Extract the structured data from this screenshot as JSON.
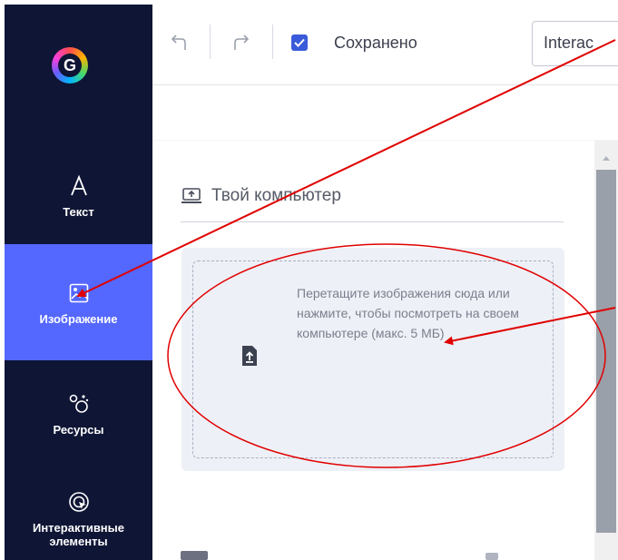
{
  "sidebar": {
    "logo_letter": "G",
    "items": [
      {
        "label": "Текст",
        "icon": "text-a-icon"
      },
      {
        "label": "Изображение",
        "icon": "image-icon"
      },
      {
        "label": "Ресурсы",
        "icon": "resources-icon"
      },
      {
        "label": "Интерактивные элементы",
        "icon": "interactive-cursor-icon"
      }
    ],
    "active_index": 1
  },
  "toolbar": {
    "undo_icon": "undo-icon",
    "redo_icon": "redo-icon",
    "saved_label": "Сохранено",
    "project_title": "Interac"
  },
  "panel": {
    "section_title": "Твой компьютер",
    "upload_hint": "Перетащите изображения сюда или нажмите, чтобы посмотреть на своем компьютере (макс. 5 МБ)"
  },
  "colors": {
    "sidebar_bg": "#0f1535",
    "active_item": "#5467ff",
    "annotation": "#e00000"
  }
}
